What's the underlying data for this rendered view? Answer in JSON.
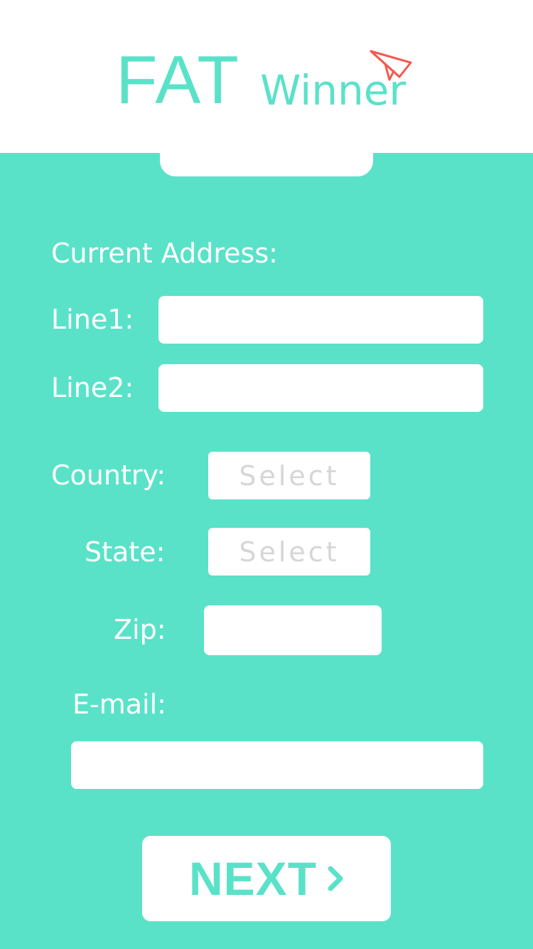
{
  "header": {
    "logo_main": "FAT",
    "logo_sub": "Winner",
    "logo_icon": "paper-plane-icon",
    "accent_color": "#5ae2c9",
    "icon_color": "#f25a50"
  },
  "form": {
    "section_title": "Current Address:",
    "line1_label": "Line1:",
    "line1_value": "",
    "line2_label": "Line2:",
    "line2_value": "",
    "country_label": "Country:",
    "country_value": "Select",
    "state_label": "State:",
    "state_value": "Select",
    "zip_label": "Zip:",
    "zip_value": "",
    "email_label": "E-mail:",
    "email_value": ""
  },
  "actions": {
    "next_label": "NEXT",
    "next_icon": "chevron-right-icon"
  },
  "colors": {
    "background": "#5ae2c9",
    "surface": "#ffffff",
    "placeholder": "#d6d6d6"
  }
}
